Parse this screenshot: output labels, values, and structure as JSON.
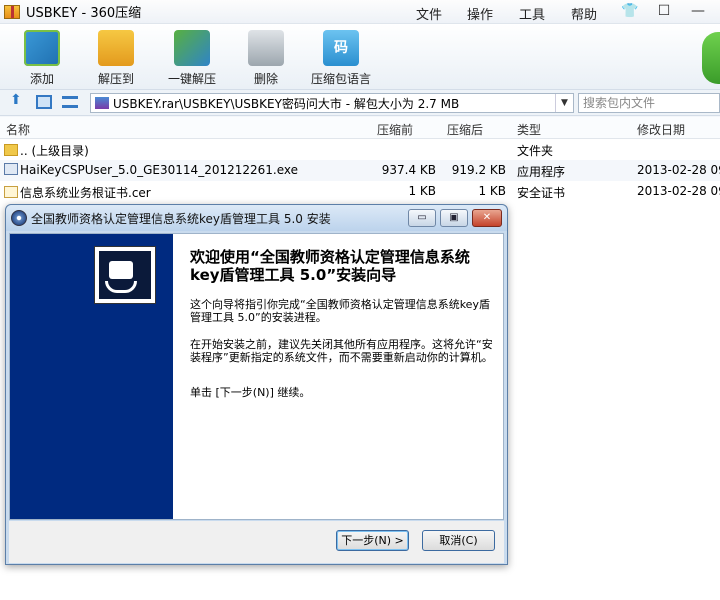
{
  "window": {
    "title": "USBKEY - 360压缩",
    "menu": [
      "文件",
      "操作",
      "工具",
      "帮助"
    ],
    "tshirt_icon": "👕",
    "minimize_icon": "☐",
    "restore_icon": "—"
  },
  "toolbar": {
    "add": "添加",
    "extract_to": "解压到",
    "one_click_extract": "一键解压",
    "delete": "删除",
    "archive_language": "压缩包语言",
    "archive_language_glyph": "码"
  },
  "address_bar": {
    "path": "USBKEY.rar\\USBKEY\\USBKEY密码问大市 - 解包大小为 2.7 MB",
    "search_placeholder": "搜索包内文件"
  },
  "columns": {
    "name": "名称",
    "compressed": "压缩前",
    "packed": "压缩后",
    "type": "类型",
    "modified": "修改日期"
  },
  "files": [
    {
      "name": ".. (上级目录)",
      "before": "",
      "after": "",
      "type": "文件夹",
      "date": ""
    },
    {
      "name": "HaiKeyCSPUser_5.0_GE30114_201212261.exe",
      "before": "937.4 KB",
      "after": "919.2 KB",
      "type": "应用程序",
      "date": "2013-02-28 09"
    },
    {
      "name": "信息系统业务根证书.cer",
      "before": "1 KB",
      "after": "1 KB",
      "type": "安全证书",
      "date": "2013-02-28 09"
    }
  ],
  "installer": {
    "title": "全国教师资格认定管理信息系统key盾管理工具 5.0 安装",
    "heading": "欢迎使用“全国教师资格认定管理信息系统key盾管理工具 5.0”安装向导",
    "para1": "这个向导将指引你完成“全国教师资格认定管理信息系统key盾管理工具 5.0”的安装进程。",
    "para2": "在开始安装之前，建议先关闭其他所有应用程序。这将允许“安装程序”更新指定的系统文件，而不需要重新启动你的计算机。",
    "para3": "单击 [下一步(N)] 继续。",
    "next_button": "下一步(N) >",
    "cancel_button": "取消(C)",
    "min_label": "▭",
    "max_label": "▣",
    "close_label": "✕"
  }
}
